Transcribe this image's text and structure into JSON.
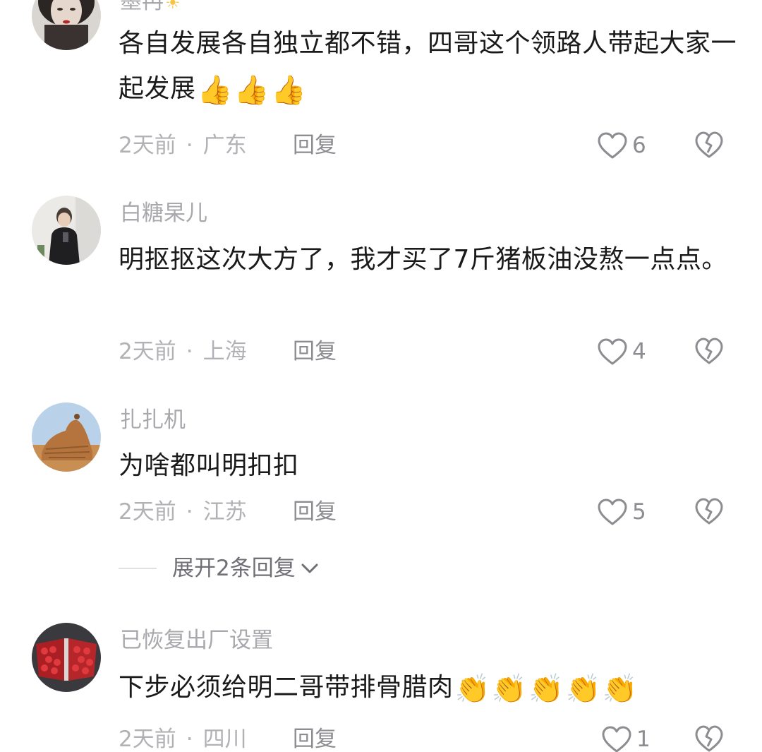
{
  "comments": [
    {
      "username": "墨冉",
      "username_suffix": "☀",
      "text": "各自发展各自独立都不错，四哥这个领路人带起大家一起发展",
      "emojis": [
        "👍",
        "👍",
        "👍"
      ],
      "time": "2天前",
      "location": "广东",
      "reply_label": "回复",
      "likes": "6"
    },
    {
      "username": "白糖杲儿",
      "text": "明抠抠这次大方了，我才买了7斤猪板油没熬一点点。",
      "time": "2天前",
      "location": "上海",
      "reply_label": "回复",
      "likes": "4"
    },
    {
      "username": "扎扎机",
      "text": "为啥都叫明扣扣",
      "time": "2天前",
      "location": "江苏",
      "reply_label": "回复",
      "likes": "5",
      "expand_label": "展开2条回复"
    },
    {
      "username": "已恢复出厂设置",
      "text": "下步必须给明二哥带排骨腊肉",
      "emojis": [
        "👏",
        "👏",
        "👏",
        "👏",
        "👏"
      ],
      "time": "2天前",
      "location": "四川",
      "reply_label": "回复",
      "likes": "1"
    }
  ],
  "meta_separator": "·",
  "icons": {
    "like": "heart-outline-icon",
    "dislike": "broken-heart-icon",
    "expand": "chevron-down-icon"
  },
  "colors": {
    "text": "#1a1a1a",
    "secondary": "#a8a8ad",
    "icon": "#8c8c91"
  }
}
